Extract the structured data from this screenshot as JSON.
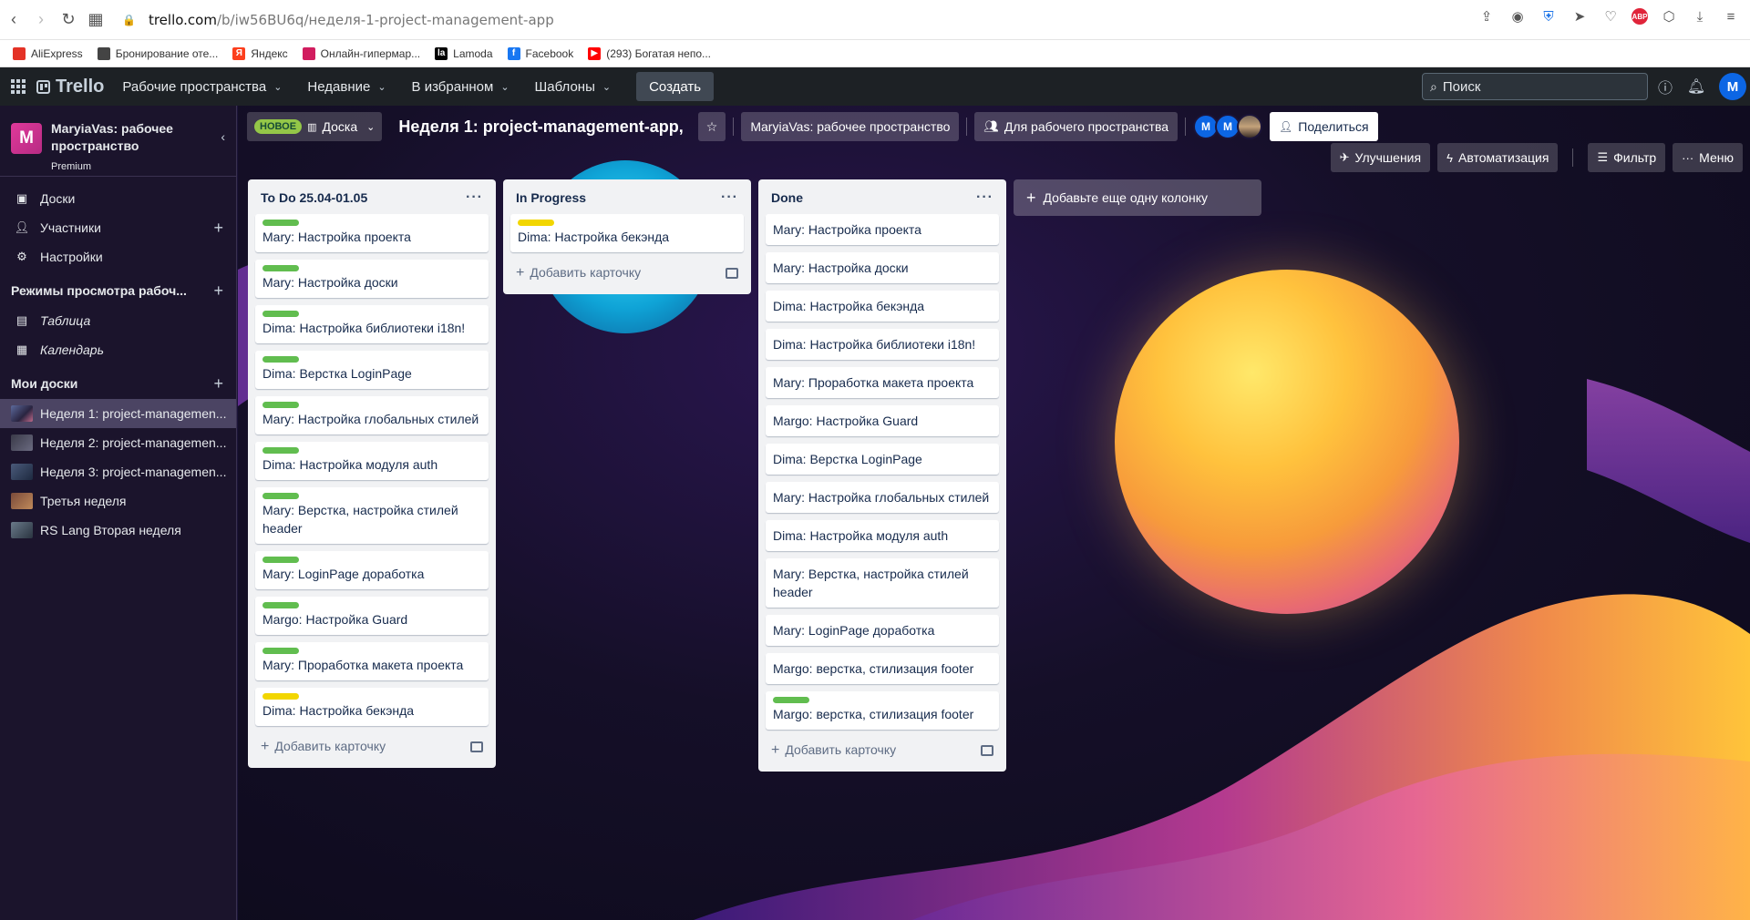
{
  "browser": {
    "url_host": "trello.com",
    "url_path": "/b/iw56BU6q/неделя-1-project-management-app",
    "bookmarks": [
      {
        "label": "AliExpress",
        "color": "#e43226"
      },
      {
        "label": "Бронирование оте...",
        "color": "#444"
      },
      {
        "label": "Яндекс",
        "color": "#fc3f1d",
        "glyph": "Я"
      },
      {
        "label": "Онлайн-гипермар...",
        "color": "#d11d5f"
      },
      {
        "label": "Lamoda",
        "color": "#000",
        "glyph": "la"
      },
      {
        "label": "Facebook",
        "color": "#1877f2",
        "glyph": "f"
      },
      {
        "label": "(293) Богатая непо...",
        "color": "#ff0000",
        "glyph": "▶"
      }
    ]
  },
  "header": {
    "brand": "Trello",
    "nav": [
      "Рабочие пространства",
      "Недавние",
      "В избранном",
      "Шаблоны"
    ],
    "create_label": "Создать",
    "search_placeholder": "Поиск",
    "avatar_initial": "M"
  },
  "sidebar": {
    "workspace_initial": "M",
    "workspace_name": "MaryiaVas: рабочее пространство",
    "workspace_plan": "Premium",
    "items": [
      {
        "label": "Доски",
        "icon": "trello-board-icon"
      },
      {
        "label": "Участники",
        "icon": "person-icon"
      },
      {
        "label": "Настройки",
        "icon": "gear-icon"
      }
    ],
    "views_section": "Режимы просмотра рабоч...",
    "views": [
      {
        "label": "Таблица",
        "icon": "table-icon"
      },
      {
        "label": "Календарь",
        "icon": "calendar-icon"
      }
    ],
    "boards_section": "Мои доски",
    "boards": [
      {
        "label": "Неделя 1: project-managemen...",
        "active": true
      },
      {
        "label": "Неделя 2: project-managemen...",
        "active": false
      },
      {
        "label": "Неделя 3: project-managemen...",
        "active": false
      },
      {
        "label": "Третья неделя",
        "active": false
      },
      {
        "label": "RS Lang Вторая неделя",
        "active": false
      }
    ]
  },
  "board": {
    "new_badge": "НОВОЕ",
    "view_label": "Доска",
    "title": "Неделя 1: project-management-app,",
    "workspace_button": "MaryiaVas: рабочее пространство",
    "visibility_button": "Для рабочего пространства",
    "member_initials": [
      "M",
      "M"
    ],
    "share_label": "Поделиться",
    "powerups_label": "Улучшения",
    "automation_label": "Автоматизация",
    "filter_label": "Фильтр",
    "menu_label": "Меню",
    "add_list_label": "Добавьте еще одну колонку",
    "add_card_label": "Добавить карточку"
  },
  "lists": [
    {
      "title": "To Do 25.04-01.05",
      "cards": [
        {
          "text": "Mary: Настройка проекта",
          "label": "green"
        },
        {
          "text": "Mary: Настройка доски",
          "label": "green"
        },
        {
          "text": "Dima: Настройка библиотеки i18n!",
          "label": "green"
        },
        {
          "text": "Dima: Верстка LoginPage",
          "label": "green"
        },
        {
          "text": "Mary: Настройка глобальных стилей",
          "label": "green"
        },
        {
          "text": "Dima: Настройка модуля auth",
          "label": "green"
        },
        {
          "text": "Mary: Верстка, настройка стилей header",
          "label": "green"
        },
        {
          "text": "Mary: LoginPage доработка",
          "label": "green"
        },
        {
          "text": "Margo: Настройка Guard",
          "label": "green"
        },
        {
          "text": "Mary: Проработка макета проекта",
          "label": "green"
        },
        {
          "text": "Dima: Настройка бекэнда",
          "label": "yellow"
        }
      ]
    },
    {
      "title": "In Progress",
      "cards": [
        {
          "text": "Dima: Настройка бекэнда",
          "label": "yellow"
        }
      ]
    },
    {
      "title": "Done",
      "cards": [
        {
          "text": "Mary: Настройка проекта",
          "label": ""
        },
        {
          "text": "Mary: Настройка доски",
          "label": ""
        },
        {
          "text": "Dima: Настройка бекэнда",
          "label": ""
        },
        {
          "text": "Dima: Настройка библиотеки i18n!",
          "label": ""
        },
        {
          "text": "Mary: Проработка макета проекта",
          "label": ""
        },
        {
          "text": "Margo: Настройка Guard",
          "label": ""
        },
        {
          "text": "Dima: Верстка LoginPage",
          "label": ""
        },
        {
          "text": "Mary: Настройка глобальных стилей",
          "label": ""
        },
        {
          "text": "Dima: Настройка модуля auth",
          "label": ""
        },
        {
          "text": "Mary: Верстка, настройка стилей header",
          "label": ""
        },
        {
          "text": "Mary: LoginPage доработка",
          "label": ""
        },
        {
          "text": "Margo: верстка, стилизация footer",
          "label": ""
        },
        {
          "text": "Margo: верстка, стилизация footer",
          "label": "green"
        }
      ]
    }
  ]
}
